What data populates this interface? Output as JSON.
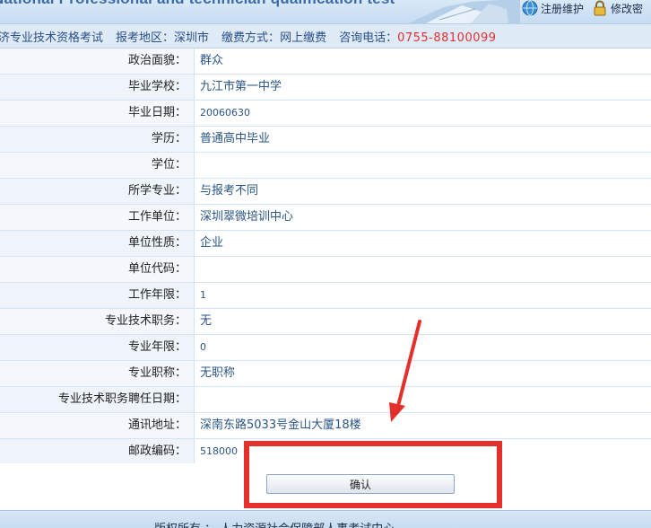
{
  "header": {
    "banner_title": "National Professional and technician qualification test",
    "links": [
      {
        "label": "注册维护",
        "icon": "globe-icon"
      },
      {
        "label": "修改密",
        "icon": "lock-icon"
      }
    ]
  },
  "infobar": {
    "exam_name": "济专业技术资格考试",
    "region_label": "报考地区：",
    "region_value": "深圳市",
    "payment_label": "缴费方式：",
    "payment_value": "网上缴费",
    "phone_label": "咨询电话：",
    "phone_value": "0755-88100099"
  },
  "form": {
    "rows": [
      {
        "label": "政治面貌：",
        "value": "群众"
      },
      {
        "label": "毕业学校：",
        "value": "九江市第一中学"
      },
      {
        "label": "毕业日期：",
        "value": "20060630"
      },
      {
        "label": "学历：",
        "value": "普通高中毕业"
      },
      {
        "label": "学位：",
        "value": ""
      },
      {
        "label": "所学专业：",
        "value": "与报考不同"
      },
      {
        "label": "工作单位：",
        "value": "深圳翠微培训中心"
      },
      {
        "label": "单位性质：",
        "value": "企业"
      },
      {
        "label": "单位代码：",
        "value": ""
      },
      {
        "label": "工作年限：",
        "value": "1"
      },
      {
        "label": "专业技术职务：",
        "value": "无"
      },
      {
        "label": "专业年限：",
        "value": "0"
      },
      {
        "label": "专业职称：",
        "value": "无职称"
      },
      {
        "label": "专业技术职务聘任日期：",
        "value": ""
      },
      {
        "label": "通讯地址：",
        "value": "深南东路5033号金山大厦18楼"
      },
      {
        "label": "邮政编码：",
        "value": "518000"
      }
    ]
  },
  "actions": {
    "confirm_label": "确认"
  },
  "footer": {
    "text": "版权所有 ： 人力资源社会保障部人事考试中心"
  },
  "colors": {
    "accent": "#2a5587",
    "highlight": "#e4302a",
    "phone": "#e03030"
  }
}
